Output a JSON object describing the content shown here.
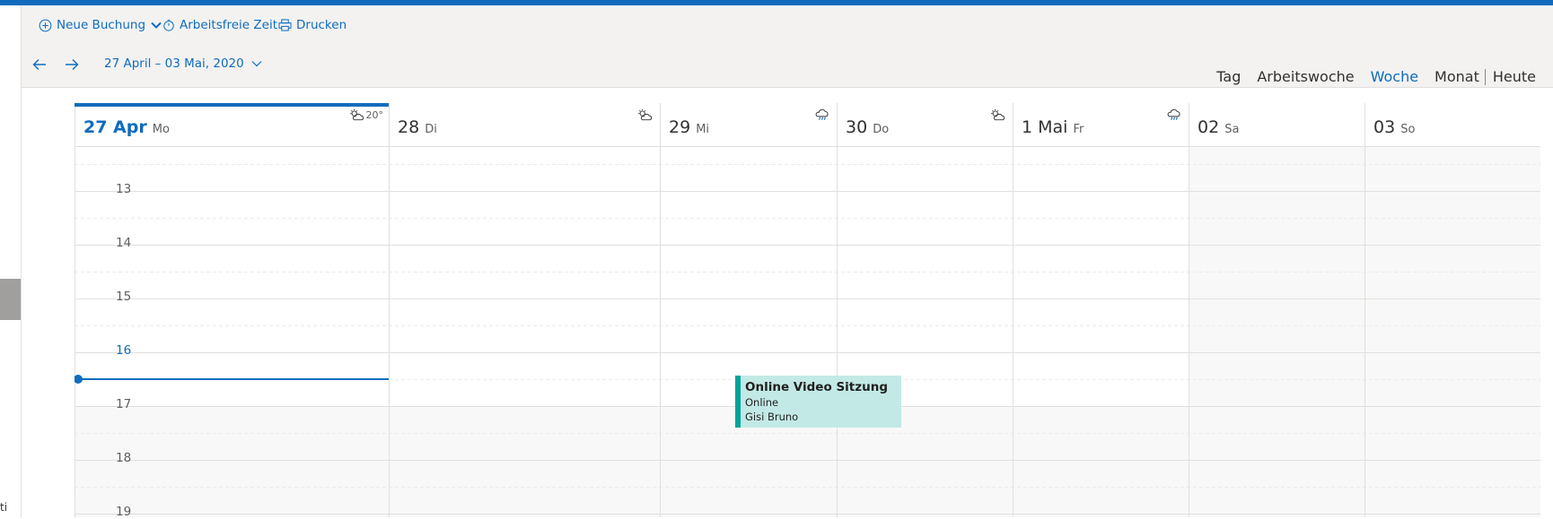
{
  "left_pane": {
    "cut_text": "ti"
  },
  "commands": {
    "new_booking": "Neue Buchung",
    "off_time": "Arbeitsfreie Zeit",
    "print": "Drucken"
  },
  "nav": {
    "range": "27 April – 03 Mai, 2020"
  },
  "views": {
    "day": "Tag",
    "work_week": "Arbeitswoche",
    "week": "Woche",
    "month": "Monat",
    "today": "Heute",
    "active": "Woche"
  },
  "days": [
    {
      "num": "27 Apr",
      "name": "Mo",
      "weather_icon": "partly-sunny-icon",
      "temp": "20°",
      "today": true
    },
    {
      "num": "28",
      "name": "Di",
      "weather_icon": "partly-sunny-icon"
    },
    {
      "num": "29",
      "name": "Mi",
      "weather_icon": "rain-cloud-icon"
    },
    {
      "num": "30",
      "name": "Do",
      "weather_icon": "partly-sunny-icon"
    },
    {
      "num": "1 Mai",
      "name": "Fr",
      "weather_icon": "rain-cloud-icon"
    },
    {
      "num": "02",
      "name": "Sa"
    },
    {
      "num": "03",
      "name": "So"
    }
  ],
  "hours": [
    "13",
    "14",
    "15",
    "16",
    "17",
    "18",
    "19"
  ],
  "current_hour": "16",
  "event": {
    "title": "Online Video Sitzung",
    "location": "Online",
    "organizer": "Gisi Bruno"
  },
  "colors": {
    "accent": "#0f6cbd",
    "event_fill": "#c2e9e6",
    "event_bar": "#00a39a",
    "nonworking": "#f8f8f8"
  }
}
